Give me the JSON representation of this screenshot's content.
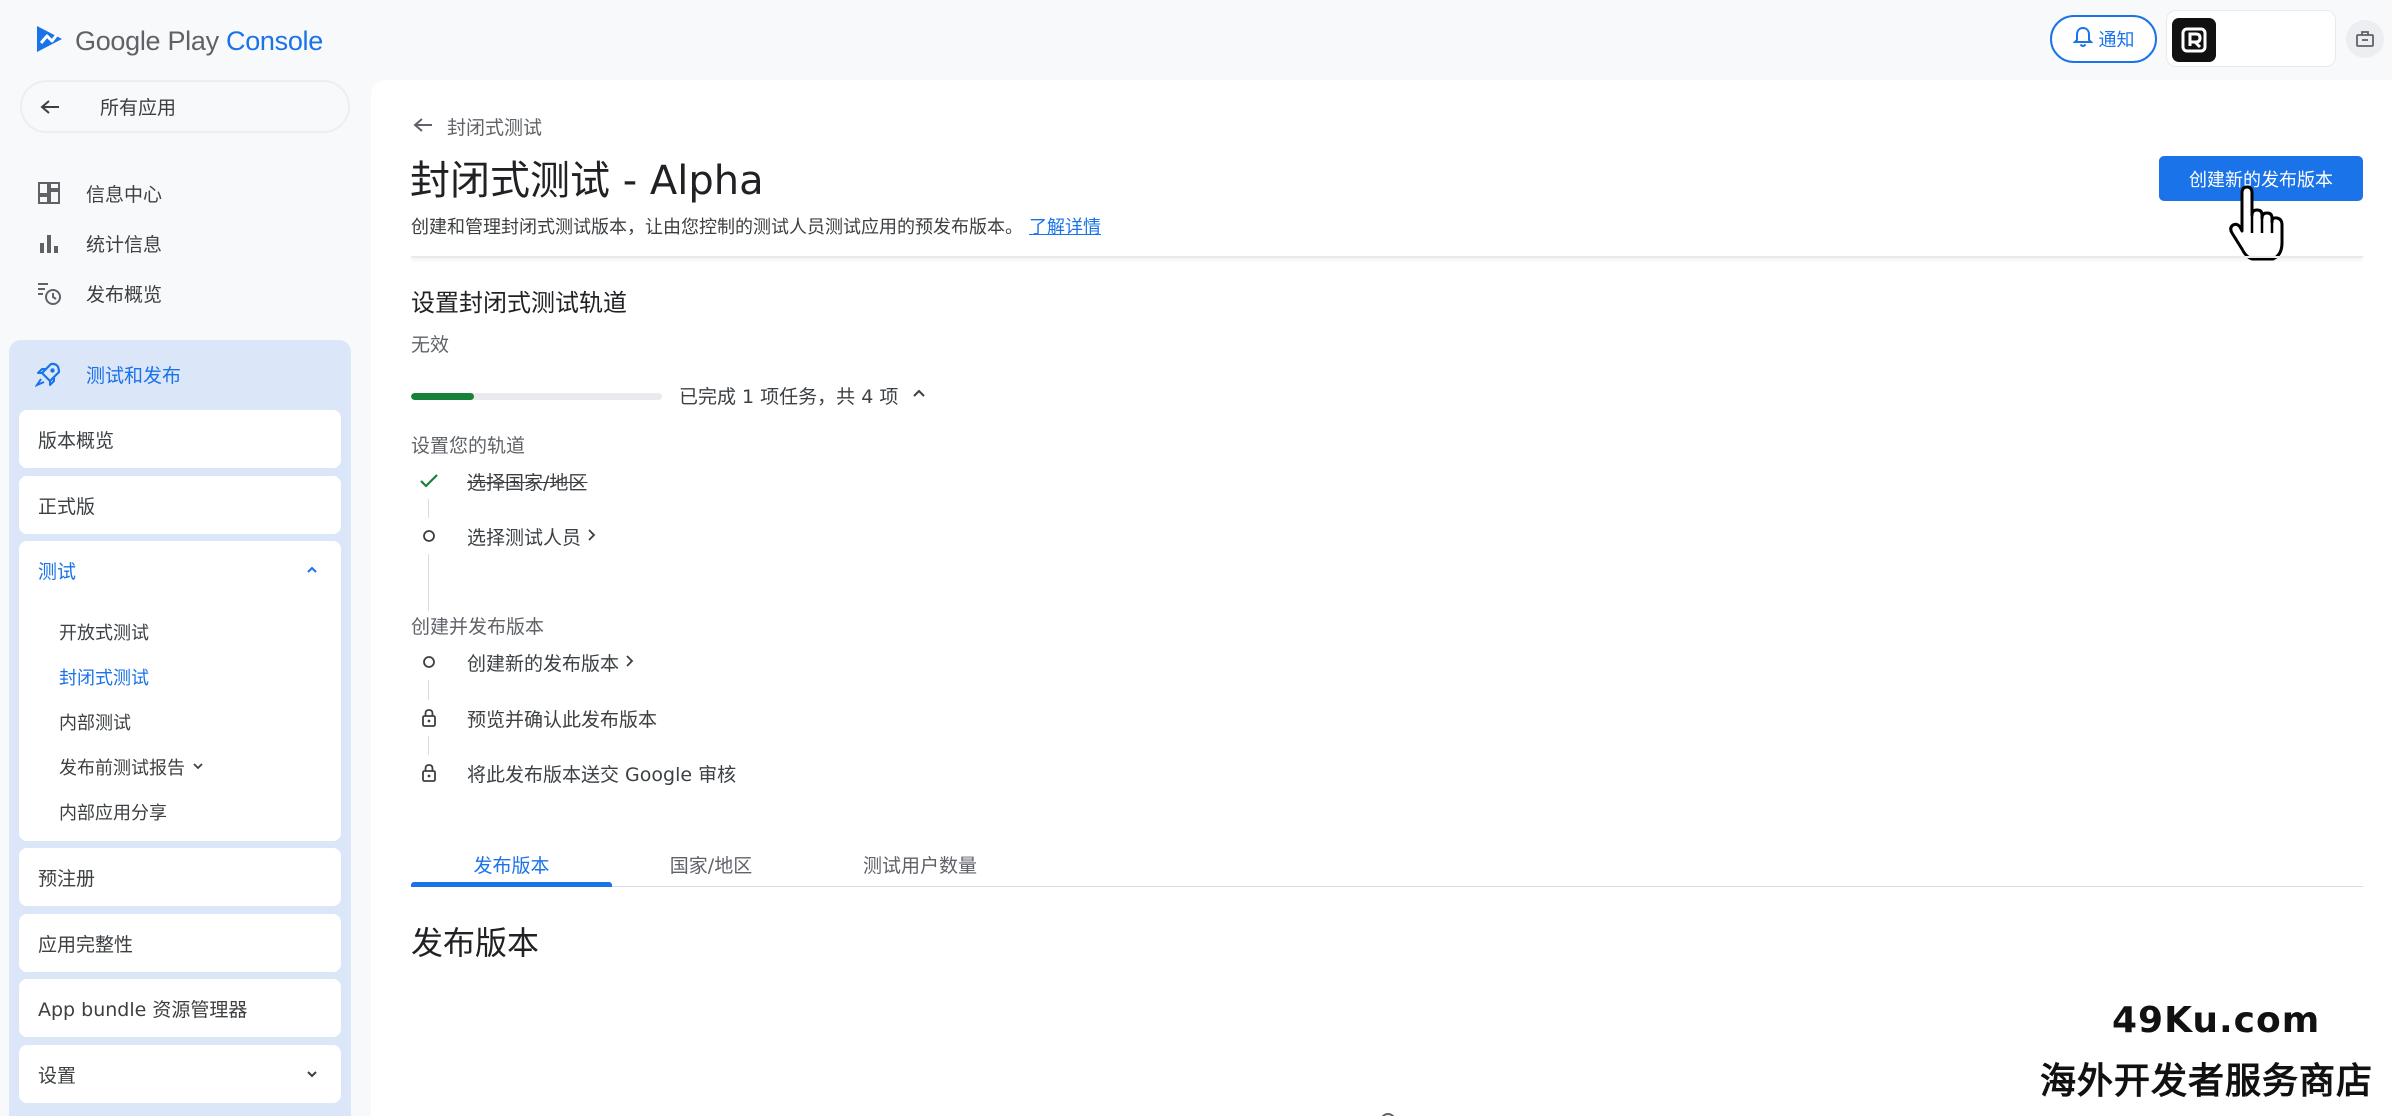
{
  "header": {
    "logo_text_play": "Google Play ",
    "logo_text_console": "Console",
    "notify_label": "通知"
  },
  "sidebar": {
    "back_label": "所有应用",
    "top_items": [
      {
        "label": "信息中心",
        "icon": "dashboard-icon"
      },
      {
        "label": "统计信息",
        "icon": "bar-chart-icon"
      },
      {
        "label": "发布概览",
        "icon": "publishing-history-icon"
      }
    ],
    "section": {
      "label": "测试和发布",
      "icon": "rocket-icon"
    },
    "cards": {
      "release_overview": "版本概览",
      "production": "正式版",
      "testing": "测试",
      "pre_registration": "预注册",
      "app_integrity": "应用完整性",
      "bundle_explorer": "App bundle 资源管理器",
      "settings": "设置"
    },
    "testing_sub": [
      {
        "label": "开放式测试",
        "active": false
      },
      {
        "label": "封闭式测试",
        "active": true
      },
      {
        "label": "内部测试",
        "active": false
      },
      {
        "label": "发布前测试报告",
        "active": false
      },
      {
        "label": "内部应用分享",
        "active": false
      }
    ]
  },
  "main": {
    "breadcrumb": "封闭式测试",
    "title": "封闭式测试 - Alpha",
    "description": "创建和管理封闭式测试版本，让由您控制的测试人员测试应用的预发布版本。",
    "learn_more": "了解详情",
    "create_button": "创建新的发布版本",
    "setup": {
      "title": "设置封闭式测试轨道",
      "status": "无效",
      "progress_text": "已完成 1 项任务，共 4 项",
      "progress_fraction": 0.25,
      "group1_label": "设置您的轨道",
      "group1_tasks": [
        {
          "label": "选择国家/地区",
          "state": "done"
        },
        {
          "label": "选择测试人员",
          "state": "todo",
          "link": true
        }
      ],
      "group2_label": "创建并发布版本",
      "group2_tasks": [
        {
          "label": "创建新的发布版本",
          "state": "todo",
          "link": true
        },
        {
          "label": "预览并确认此发布版本",
          "state": "locked"
        },
        {
          "label": "将此发布版本送交 Google 审核",
          "state": "locked"
        }
      ]
    },
    "tabs": [
      {
        "label": "发布版本",
        "active": true
      },
      {
        "label": "国家/地区",
        "active": false
      },
      {
        "label": "测试用户数量",
        "active": false
      }
    ],
    "section_heading": "发布版本"
  },
  "watermark": {
    "line1": "49Ku.com",
    "line2": "海外开发者服务商店"
  },
  "colors": {
    "accent": "#1a73e8",
    "progress_green": "#188038",
    "sidebar_section_bg": "#dbe6f8"
  }
}
